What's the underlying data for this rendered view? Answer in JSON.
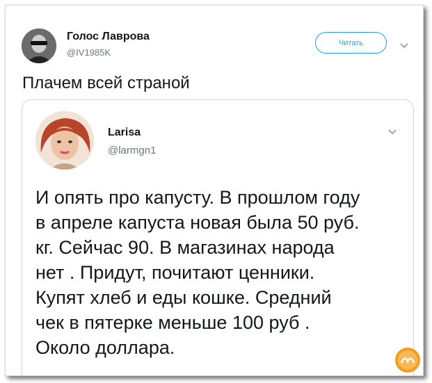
{
  "tweet": {
    "author_name": "Голос Лаврова",
    "author_handle": "@IV1985K",
    "follow_label": "Читать",
    "text": "Плачем всей страной"
  },
  "quoted": {
    "author_name": "Larisa",
    "author_handle": "@larmgn1",
    "text_lines": [
      "И опять про капусту. В прошлом году",
      "в апреле капуста новая была 50 руб.",
      "кг. Сейчас 90. В магазинах народа",
      "нет . Придут, почитают ценники.",
      "Купят хлеб и еды кошке. Средний",
      "чек в пятерке меньше 100  руб .",
      "Около доллара."
    ]
  },
  "icons": {
    "author_avatar": "person-in-sunglasses-avatar",
    "quoted_avatar": "woman-red-hair-avatar",
    "menu_caret": "chevron-down-icon",
    "watermark": "logo-watermark"
  },
  "colors": {
    "accent": "#1da1f2",
    "text": "#14171a",
    "muted": "#657786",
    "border": "#ccd6dd"
  }
}
